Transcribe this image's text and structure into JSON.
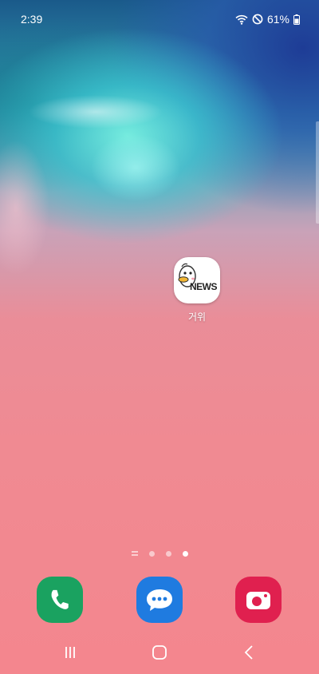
{
  "status_bar": {
    "time": "2:39",
    "battery_percent": "61%",
    "icons": [
      "wifi-icon",
      "do-not-disturb-icon",
      "battery-icon"
    ]
  },
  "home": {
    "apps": [
      {
        "label": "거위",
        "badge_text": "NEWS",
        "icon": "goose-news-icon"
      }
    ]
  },
  "page_indicator": {
    "pages": 3,
    "active_index": 2
  },
  "dock": [
    {
      "icon": "phone-icon",
      "color": "#1aa260"
    },
    {
      "icon": "messages-icon",
      "color": "#1f7be0"
    },
    {
      "icon": "camera-icon",
      "color": "#e0204f"
    }
  ],
  "nav_bar": {
    "buttons": [
      "recent-apps-icon",
      "home-icon",
      "back-icon"
    ]
  }
}
